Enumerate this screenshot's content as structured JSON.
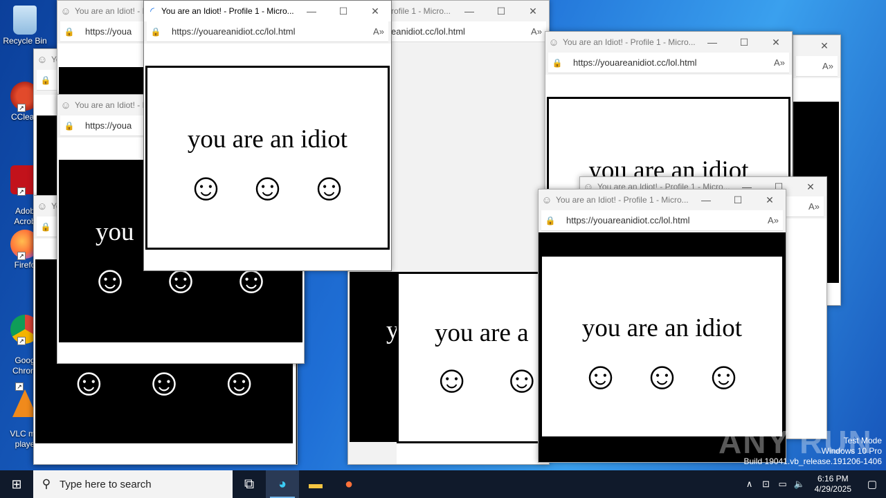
{
  "desktop_icons": [
    {
      "name": "recycle-bin",
      "label": "Recycle Bin"
    },
    {
      "name": "ccleaner",
      "label": "CClean"
    },
    {
      "name": "adobe-acrobat",
      "label": "Adob\nAcrob"
    },
    {
      "name": "firefox",
      "label": "Firefo"
    },
    {
      "name": "google-chrome",
      "label": "Goog\nChrom"
    },
    {
      "name": "vlc",
      "label": "VLC me\nplaye"
    }
  ],
  "browser": {
    "title": "You are an Idiot! - Profile 1 - Micro...",
    "title_short": "You are an Idiot! - P",
    "title_frag": "rofile 1 - Micro...",
    "title_you": "Yo",
    "url": "https://youareanidiot.cc/lol.html",
    "url_short": "https://youa",
    "url_frag": "eanidiot.cc/lol.html"
  },
  "page": {
    "text": "you are an idiot",
    "text_frag1": "you",
    "text_frag2": "you are a",
    "text_frag3": "y",
    "smiley": "☺"
  },
  "taskbar": {
    "search_placeholder": "Type here to search",
    "time": "6:16 PM",
    "date": "4/29/2025"
  },
  "watermark": {
    "line1": "Test Mode",
    "line2": "Windows 10 Pro",
    "line3": "Build 19041.vb_release.191206-1406",
    "brand": "ANY RUN"
  },
  "colors": {
    "accent": "#76b9ed",
    "taskbar": "#101a2b"
  }
}
